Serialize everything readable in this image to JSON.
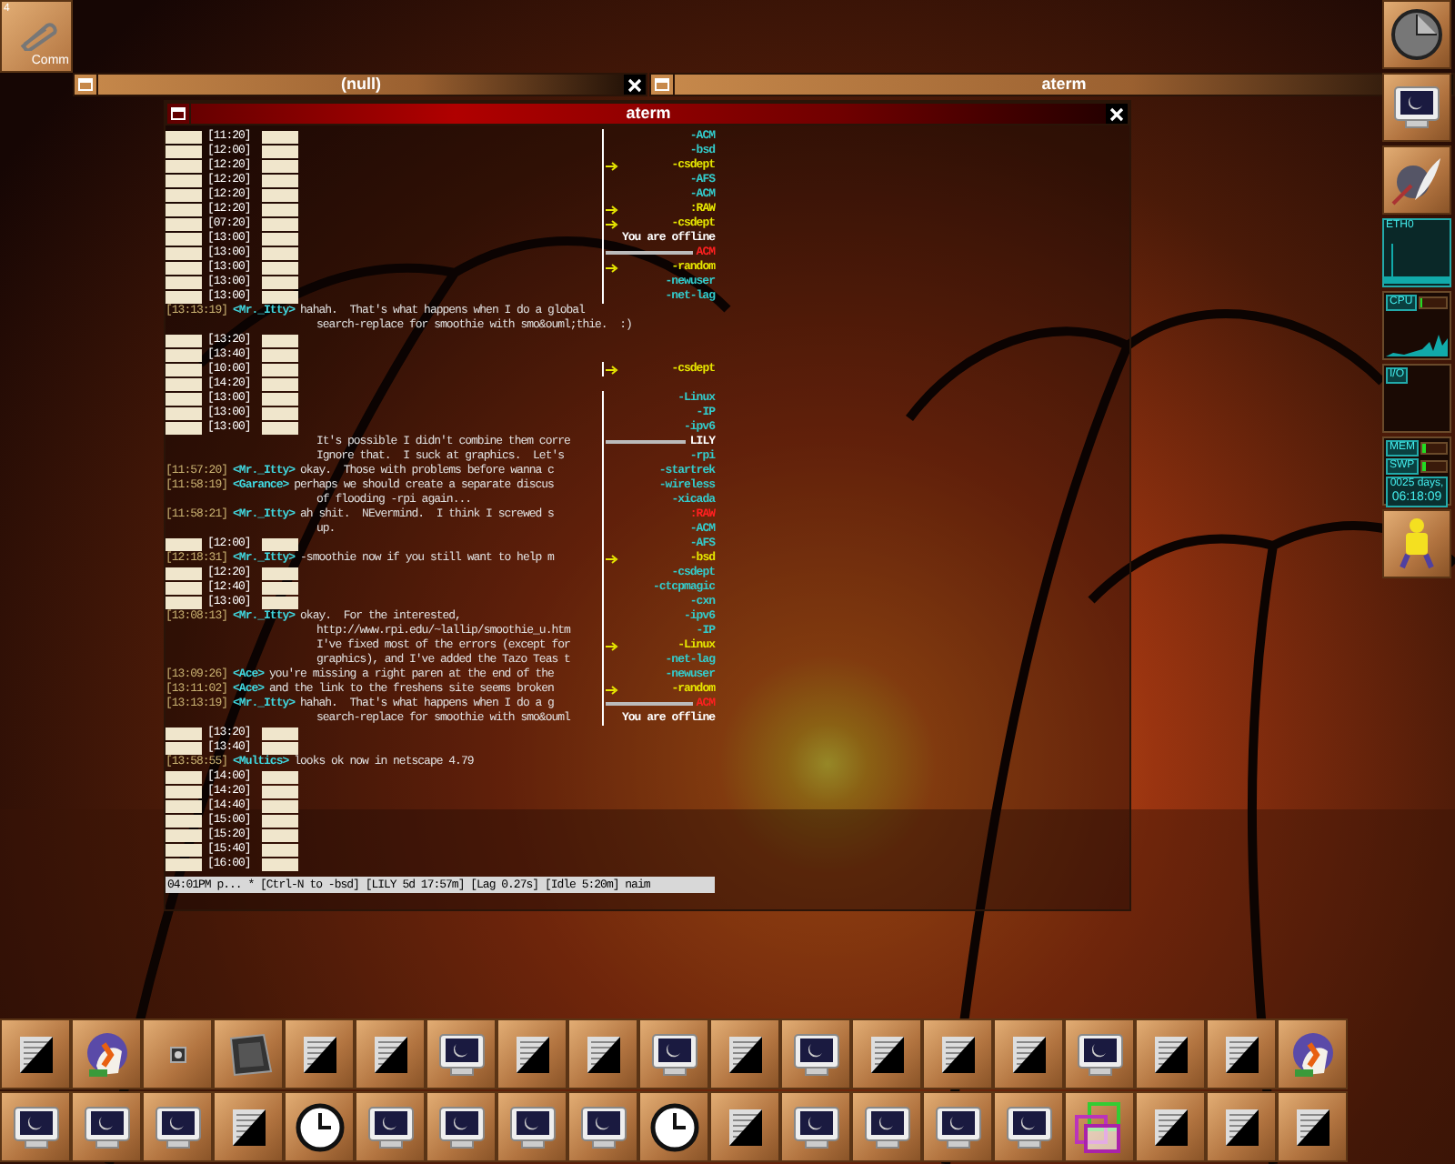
{
  "workspace": {
    "number": "4",
    "label": "Comm"
  },
  "windows": [
    {
      "title": "(null)",
      "active": false
    },
    {
      "title": "aterm",
      "active": false
    },
    {
      "title": "aterm",
      "active": true
    }
  ],
  "terminal": {
    "lines": [
      {
        "left": {
          "kind": "separator",
          "time": "[11:20]"
        },
        "right": {
          "label": "-ACM",
          "color": "#33cccc",
          "flagged": false,
          "linked": false
        }
      },
      {
        "left": {
          "kind": "separator",
          "time": "[12:00]"
        },
        "right": {
          "label": "-bsd",
          "color": "#33cccc",
          "flagged": false,
          "linked": false
        }
      },
      {
        "left": {
          "kind": "separator",
          "time": "[12:20]"
        },
        "right": {
          "label": "-csdept",
          "color": "#e6e600",
          "flagged": true,
          "linked": false
        }
      },
      {
        "left": {
          "kind": "separator",
          "time": "[12:20]"
        },
        "right": {
          "label": "-AFS",
          "color": "#33cccc",
          "flagged": false,
          "linked": false
        }
      },
      {
        "left": {
          "kind": "separator",
          "time": "[12:20]"
        },
        "right": {
          "label": "-ACM",
          "color": "#33cccc",
          "flagged": false,
          "linked": false
        }
      },
      {
        "left": {
          "kind": "separator",
          "time": "[12:20]"
        },
        "right": {
          "label": ":RAW",
          "color": "#e6e600",
          "flagged": true,
          "linked": false
        }
      },
      {
        "left": {
          "kind": "separator",
          "time": "[07:20]"
        },
        "right": {
          "label": "-csdept",
          "color": "#e6e600",
          "flagged": true,
          "linked": false
        }
      },
      {
        "left": {
          "kind": "separator",
          "time": "[13:00]"
        },
        "right": {
          "label": "You are offline",
          "color": "#ffffff",
          "flagged": false,
          "linked": false
        }
      },
      {
        "left": {
          "kind": "separator",
          "time": "[13:00]"
        },
        "right": {
          "label": "ACM",
          "color": "#ff2020",
          "flagged": false,
          "linked": true
        }
      },
      {
        "left": {
          "kind": "separator",
          "time": "[13:00]"
        },
        "right": {
          "label": "-random",
          "color": "#e6e600",
          "flagged": true,
          "linked": false
        }
      },
      {
        "left": {
          "kind": "separator",
          "time": "[13:00]"
        },
        "right": {
          "label": "-newuser",
          "color": "#33cccc",
          "flagged": false,
          "linked": false
        }
      },
      {
        "left": {
          "kind": "separator",
          "time": "[13:00]"
        },
        "right": {
          "label": "-net-lag",
          "color": "#33cccc",
          "flagged": false,
          "linked": false
        }
      },
      {
        "left": {
          "kind": "message",
          "time": "[13:13:19]",
          "nick": "<Mr._Itty>",
          "text": "hahah.  That's what happens when I do a global"
        }
      },
      {
        "left": {
          "kind": "continuation",
          "text": "search-replace for smoothie with smo&ouml;thie.  :)"
        }
      },
      {
        "left": {
          "kind": "separator",
          "time": "[13:20]"
        }
      },
      {
        "left": {
          "kind": "separator",
          "time": "[13:40]"
        }
      },
      {
        "left": {
          "kind": "separator",
          "time": "[10:00]"
        },
        "right": {
          "label": "-csdept",
          "color": "#e6e600",
          "flagged": true,
          "linked": false
        }
      },
      {
        "left": {
          "kind": "separator",
          "time": "[14:20]"
        }
      },
      {
        "left": {
          "kind": "separator",
          "time": "[13:00]"
        },
        "right": {
          "label": "-Linux",
          "color": "#33cccc",
          "flagged": false,
          "linked": false
        }
      },
      {
        "left": {
          "kind": "separator",
          "time": "[13:00]"
        },
        "right": {
          "label": "-IP",
          "color": "#33cccc",
          "flagged": false,
          "linked": false
        }
      },
      {
        "left": {
          "kind": "separator",
          "time": "[13:00]"
        },
        "right": {
          "label": "-ipv6",
          "color": "#33cccc",
          "flagged": false,
          "linked": false
        }
      },
      {
        "left": {
          "kind": "continuation",
          "text": "It's possible I didn't combine them corre"
        },
        "right": {
          "label": "LILY",
          "color": "#ffffff",
          "flagged": false,
          "linked": true
        }
      },
      {
        "left": {
          "kind": "continuation",
          "text": "Ignore that.  I suck at graphics.  Let's"
        },
        "right": {
          "label": "-rpi",
          "color": "#33cccc",
          "flagged": false,
          "linked": false
        }
      },
      {
        "left": {
          "kind": "message",
          "time": "[11:57:20]",
          "nick": "<Mr._Itty>",
          "text": "okay.  Those with problems before wanna c"
        },
        "right": {
          "label": "-startrek",
          "color": "#33cccc",
          "flagged": false,
          "linked": false
        }
      },
      {
        "left": {
          "kind": "message",
          "time": "[11:58:19]",
          "nick": "<Garance>",
          "text": "perhaps we should create a separate discus"
        },
        "right": {
          "label": "-wireless",
          "color": "#33cccc",
          "flagged": false,
          "linked": false
        }
      },
      {
        "left": {
          "kind": "continuation",
          "text": "of flooding -rpi again..."
        },
        "right": {
          "label": "-xicada",
          "color": "#33cccc",
          "flagged": false,
          "linked": false
        }
      },
      {
        "left": {
          "kind": "message",
          "time": "[11:58:21]",
          "nick": "<Mr._Itty>",
          "text": "ah shit.  NEvermind.  I think I screwed s"
        },
        "right": {
          "label": ":RAW",
          "color": "#ff2020",
          "flagged": false,
          "linked": false
        }
      },
      {
        "left": {
          "kind": "continuation",
          "text": "up."
        },
        "right": {
          "label": "-ACM",
          "color": "#33cccc",
          "flagged": false,
          "linked": false
        }
      },
      {
        "left": {
          "kind": "separator",
          "time": "[12:00]"
        },
        "right": {
          "label": "-AFS",
          "color": "#33cccc",
          "flagged": false,
          "linked": false
        }
      },
      {
        "left": {
          "kind": "message",
          "time": "[12:18:31]",
          "nick": "<Mr._Itty>",
          "text": "-smoothie now if you still want to help m"
        },
        "right": {
          "label": "-bsd",
          "color": "#e6e600",
          "flagged": true,
          "linked": false
        }
      },
      {
        "left": {
          "kind": "separator",
          "time": "[12:20]"
        },
        "right": {
          "label": "-csdept",
          "color": "#33cccc",
          "flagged": false,
          "linked": false
        }
      },
      {
        "left": {
          "kind": "separator",
          "time": "[12:40]"
        },
        "right": {
          "label": "-ctcpmagic",
          "color": "#33cccc",
          "flagged": false,
          "linked": false
        }
      },
      {
        "left": {
          "kind": "separator",
          "time": "[13:00]"
        },
        "right": {
          "label": "-cxn",
          "color": "#33cccc",
          "flagged": false,
          "linked": false
        }
      },
      {
        "left": {
          "kind": "message",
          "time": "[13:08:13]",
          "nick": "<Mr._Itty>",
          "text": "okay.  For the interested,"
        },
        "right": {
          "label": "-ipv6",
          "color": "#33cccc",
          "flagged": false,
          "linked": false
        }
      },
      {
        "left": {
          "kind": "continuation",
          "text": "http://www.rpi.edu/~lallip/smoothie_u.htm"
        },
        "right": {
          "label": "-IP",
          "color": "#33cccc",
          "flagged": false,
          "linked": false
        }
      },
      {
        "left": {
          "kind": "continuation",
          "text": "I've fixed most of the errors (except for"
        },
        "right": {
          "label": "-Linux",
          "color": "#e6e600",
          "flagged": true,
          "linked": false
        }
      },
      {
        "left": {
          "kind": "continuation",
          "text": "graphics), and I've added the Tazo Teas t"
        },
        "right": {
          "label": "-net-lag",
          "color": "#33cccc",
          "flagged": false,
          "linked": false
        }
      },
      {
        "left": {
          "kind": "message",
          "time": "[13:09:26]",
          "nick": "<Ace>",
          "text": "you're missing a right paren at the end of the"
        },
        "right": {
          "label": "-newuser",
          "color": "#33cccc",
          "flagged": false,
          "linked": false
        }
      },
      {
        "left": {
          "kind": "message",
          "time": "[13:11:02]",
          "nick": "<Ace>",
          "text": "and the link to the freshens site seems broken"
        },
        "right": {
          "label": "-random",
          "color": "#e6e600",
          "flagged": true,
          "linked": false
        }
      },
      {
        "left": {
          "kind": "message",
          "time": "[13:13:19]",
          "nick": "<Mr._Itty>",
          "text": "hahah.  That's what happens when I do a g"
        },
        "right": {
          "label": "ACM",
          "color": "#ff2020",
          "flagged": false,
          "linked": true
        }
      },
      {
        "left": {
          "kind": "continuation",
          "text": "search-replace for smoothie with smo&ouml"
        },
        "right": {
          "label": "You are offline",
          "color": "#ffffff",
          "flagged": false,
          "linked": false
        }
      },
      {
        "left": {
          "kind": "separator",
          "time": "[13:20]"
        }
      },
      {
        "left": {
          "kind": "separator",
          "time": "[13:40]"
        }
      },
      {
        "left": {
          "kind": "message",
          "time": "[13:58:55]",
          "nick": "<Multics>",
          "text": "looks ok now in netscape 4.79"
        }
      },
      {
        "left": {
          "kind": "separator",
          "time": "[14:00]"
        }
      },
      {
        "left": {
          "kind": "separator",
          "time": "[14:20]"
        }
      },
      {
        "left": {
          "kind": "separator",
          "time": "[14:40]"
        }
      },
      {
        "left": {
          "kind": "separator",
          "time": "[15:00]"
        }
      },
      {
        "left": {
          "kind": "separator",
          "time": "[15:20]"
        }
      },
      {
        "left": {
          "kind": "separator",
          "time": "[15:40]"
        }
      },
      {
        "left": {
          "kind": "separator",
          "time": "[16:00]"
        }
      }
    ],
    "status_line": "04:01PM p... * [Ctrl-N to -bsd] [LILY 5d 17:57m] [Lag 0.27s] [Idle 5:20m] naim"
  },
  "dock": {
    "network_label": "ETH0",
    "cpu_label": "CPU",
    "cpu": {
      "level": 0.12
    },
    "io_label": "I/O",
    "mem_label": "MEM",
    "mem": {
      "level": 0.15
    },
    "swap_label": "SWP",
    "swap": {
      "level": 0.18
    },
    "uptime_days": "0025 days,",
    "uptime_time": "06:18:09"
  }
}
